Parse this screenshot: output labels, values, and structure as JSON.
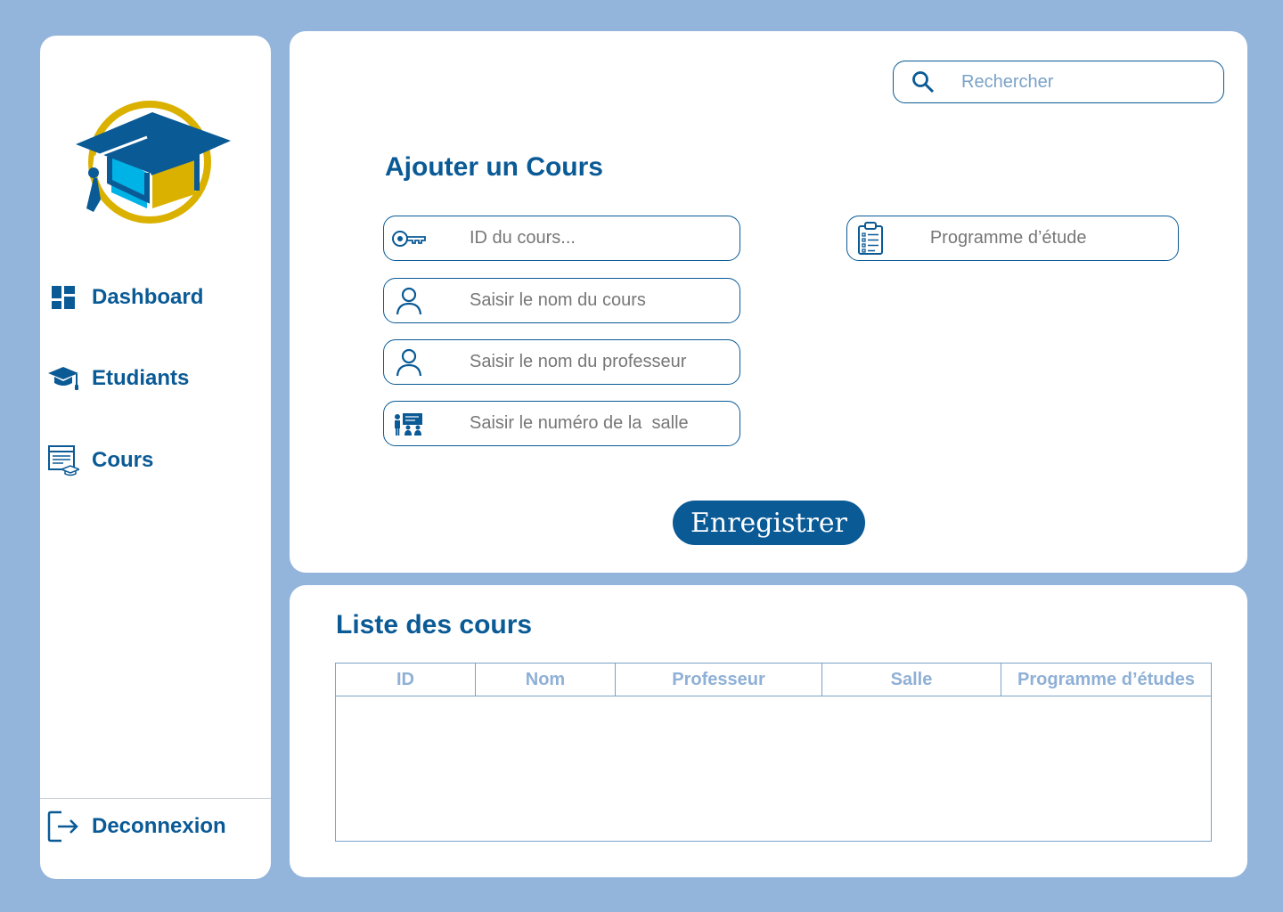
{
  "colors": {
    "background": "#93b4db",
    "primary": "#0a5a96",
    "gold": "#dbb100",
    "light_blue": "#00b3e6",
    "table_border": "#7aa2c7",
    "table_header_text": "#8fb0d6"
  },
  "sidebar": {
    "logo_icon": "graduation-cap-logo",
    "items": [
      {
        "label": "Dashboard",
        "icon": "dashboard-icon"
      },
      {
        "label": "Etudiants",
        "icon": "graduation-cap-icon"
      },
      {
        "label": "Cours",
        "icon": "course-document-icon"
      }
    ],
    "logout": {
      "label": "Deconnexion",
      "icon": "logout-icon"
    }
  },
  "search": {
    "placeholder": "Rechercher",
    "icon": "search-icon"
  },
  "form": {
    "title": "Ajouter un Cours",
    "fields": [
      {
        "placeholder": "ID du cours...",
        "icon": "key-icon"
      },
      {
        "placeholder": "Saisir le nom du cours",
        "icon": "user-icon"
      },
      {
        "placeholder": "Saisir le nom du professeur",
        "icon": "user-icon"
      },
      {
        "placeholder": "Saisir le numéro de la  salle",
        "icon": "classroom-icon"
      },
      {
        "placeholder": "Programme d’étude",
        "icon": "clipboard-list-icon"
      }
    ],
    "submit_label": "Enregistrer"
  },
  "list": {
    "title": "Liste des cours",
    "columns": [
      "ID",
      "Nom",
      "Professeur",
      "Salle",
      "Programme d’études"
    ],
    "rows": []
  }
}
